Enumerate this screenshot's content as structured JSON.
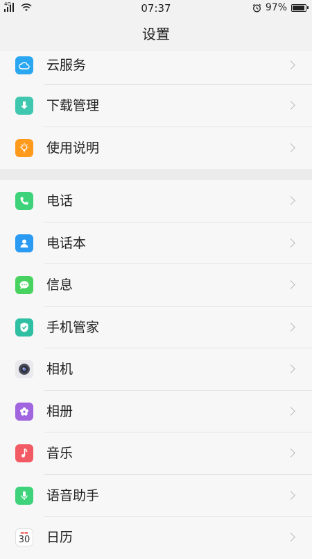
{
  "status_bar": {
    "network": "4G",
    "time": "07:37",
    "battery_percent": "97%",
    "battery_level": 0.97
  },
  "header": {
    "title": "设置"
  },
  "sections": [
    {
      "items": [
        {
          "label": "云服务",
          "icon": "cloud-icon"
        },
        {
          "label": "下载管理",
          "icon": "download-icon"
        },
        {
          "label": "使用说明",
          "icon": "lightbulb-icon"
        }
      ]
    },
    {
      "items": [
        {
          "label": "电话",
          "icon": "phone-icon"
        },
        {
          "label": "电话本",
          "icon": "contacts-icon"
        },
        {
          "label": "信息",
          "icon": "message-icon"
        },
        {
          "label": "手机管家",
          "icon": "shield-icon"
        },
        {
          "label": "相机",
          "icon": "camera-icon"
        },
        {
          "label": "相册",
          "icon": "photos-icon"
        },
        {
          "label": "音乐",
          "icon": "music-icon"
        },
        {
          "label": "语音助手",
          "icon": "microphone-icon"
        },
        {
          "label": "日历",
          "icon": "calendar-icon",
          "day": "30"
        }
      ]
    }
  ],
  "colors": {
    "cloud": "#2aa7f0",
    "download": "#3fc7b0",
    "guide": "#ff9a1d",
    "phone": "#3ed27a",
    "contacts": "#2b9af2",
    "message": "#48d25f",
    "security": "#2fbfa3",
    "photos": "#a165e0",
    "music": "#f35b64"
  }
}
